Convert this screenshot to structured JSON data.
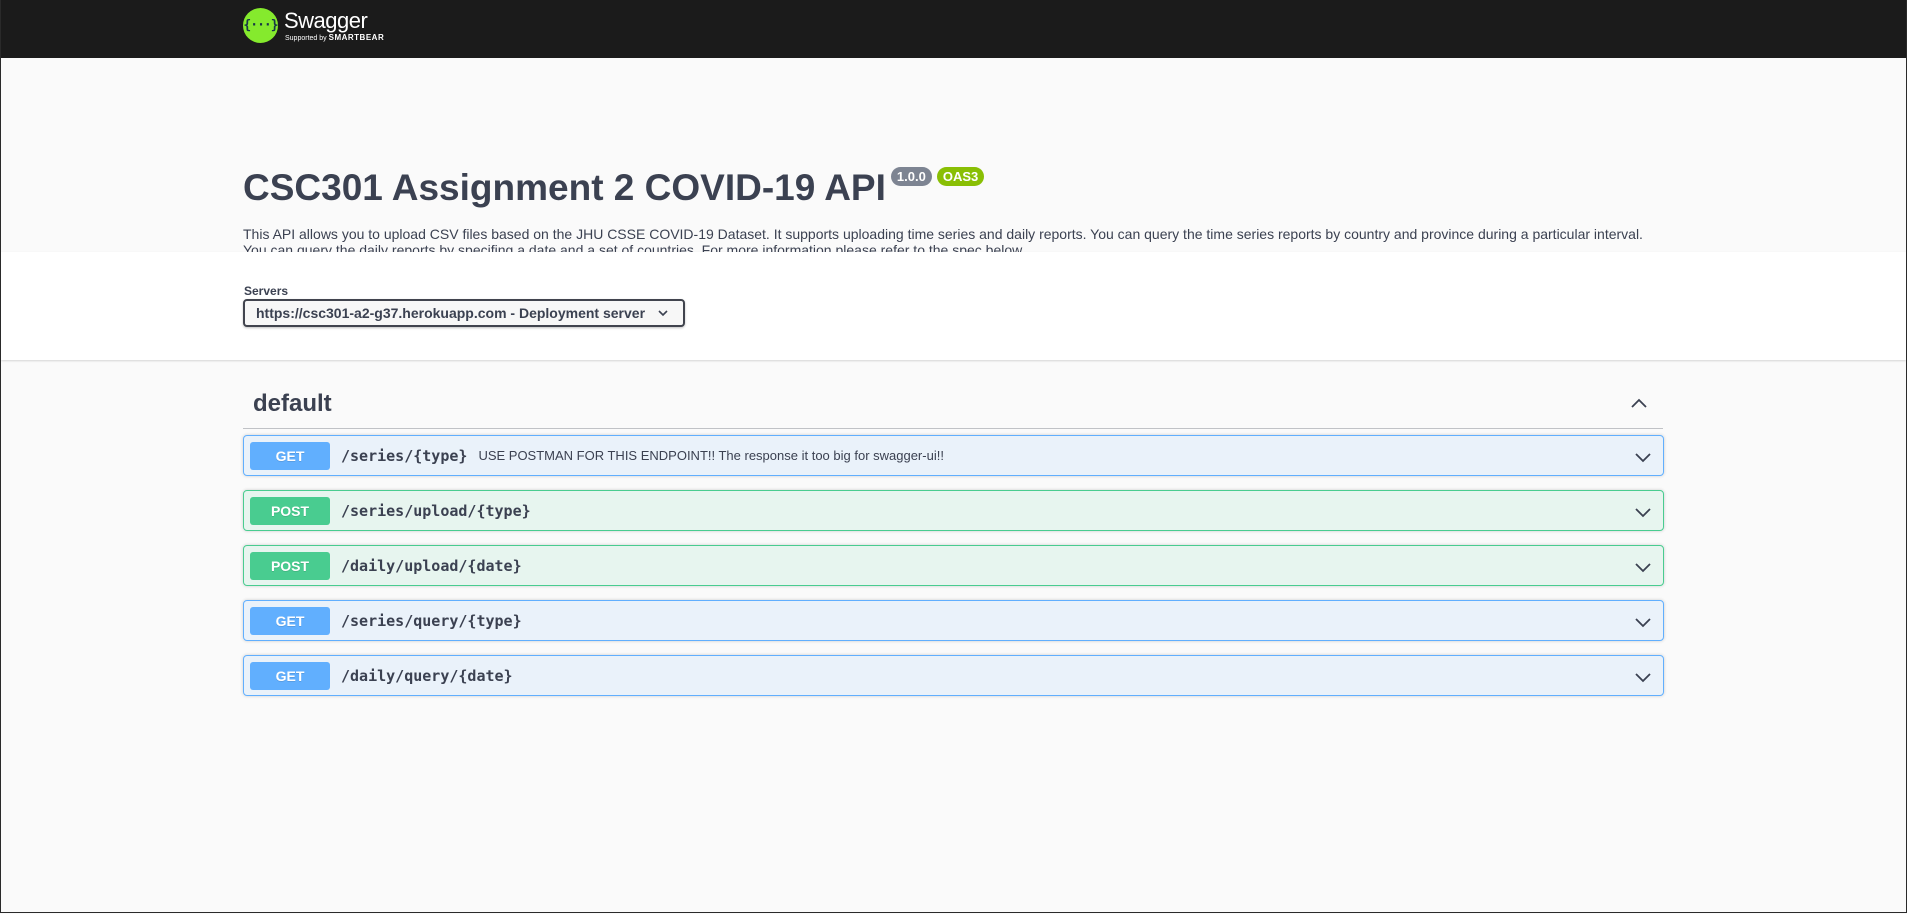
{
  "topbar": {
    "logo_glyph": "{···}",
    "brand_name": "Swagger",
    "brand_sub_prefix": "Supported by",
    "brand_sub_company": "SMARTBEAR",
    "logo_color": "#85ea2d",
    "background": "#1b1b1b"
  },
  "info": {
    "title": "CSC301 Assignment 2 COVID-19 API",
    "version_badge": "1.0.0",
    "oas_badge": "OAS3",
    "description": "This API allows you to upload CSV files based on the JHU CSSE COVID-19 Dataset. It supports uploading time series and daily reports. You can query the time series reports by country and province during a particular interval. You can query the daily reports by specifing a date and a set of countries. For more information please refer to the spec below."
  },
  "servers": {
    "label": "Servers",
    "selected": "https://csc301-a2-g37.herokuapp.com - Deployment server",
    "icon": "chevron-down-icon"
  },
  "section": {
    "title": "default",
    "toggle_icon": "chevron-up-icon"
  },
  "operations": [
    {
      "method": "GET",
      "path": "/series/{type}",
      "summary": "USE POSTMAN FOR THIS ENDPOINT!! The response it too big for swagger-ui!!"
    },
    {
      "method": "POST",
      "path": "/series/upload/{type}",
      "summary": ""
    },
    {
      "method": "POST",
      "path": "/daily/upload/{date}",
      "summary": ""
    },
    {
      "method": "GET",
      "path": "/series/query/{type}",
      "summary": ""
    },
    {
      "method": "GET",
      "path": "/daily/query/{date}",
      "summary": ""
    }
  ],
  "colors": {
    "get": "#61affe",
    "post": "#49cc90",
    "oas": "#89bf04",
    "version": "#7d8492"
  }
}
